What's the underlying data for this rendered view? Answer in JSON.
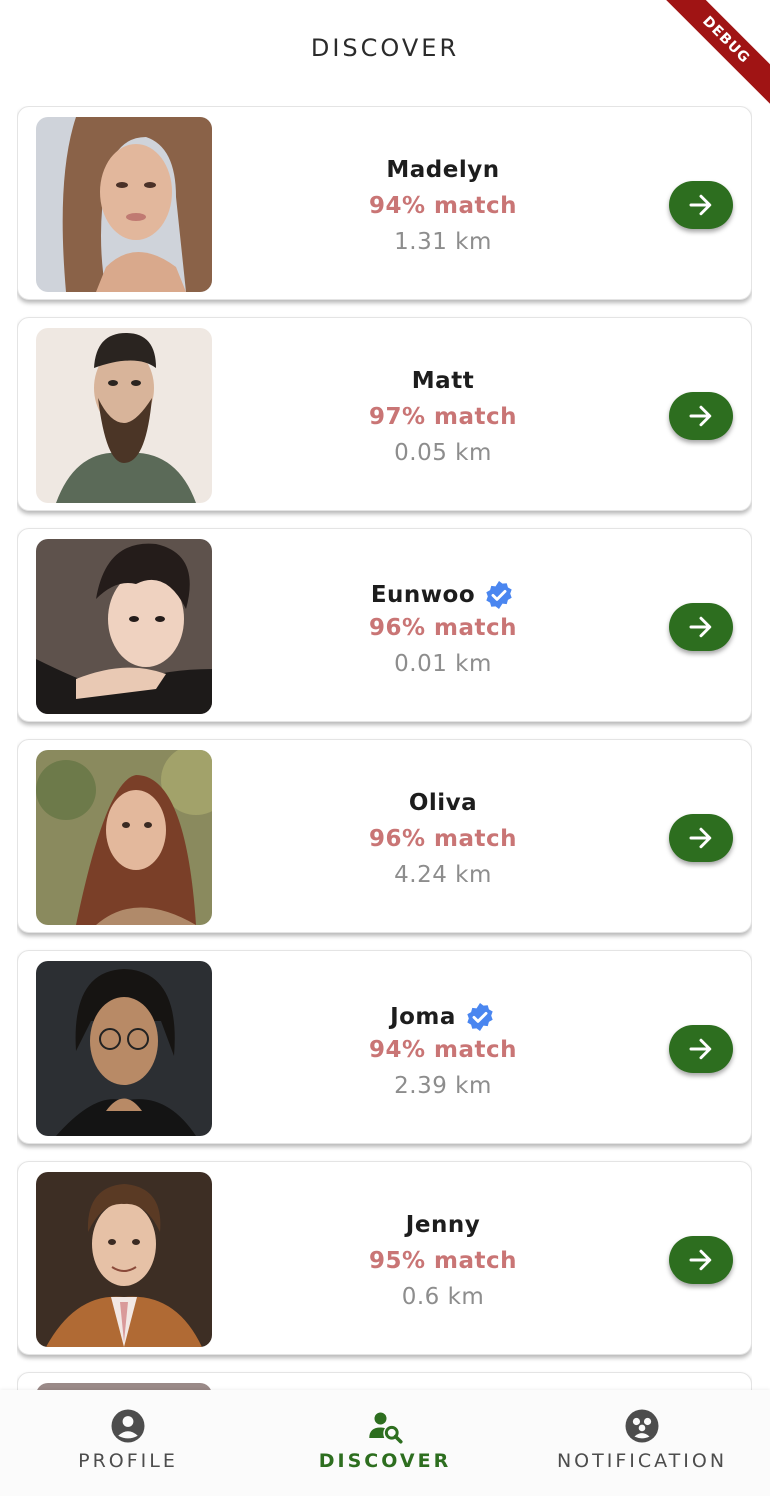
{
  "app": {
    "title": "DISCOVER",
    "debug_label": "DEBUG"
  },
  "colors": {
    "accent": "#2d6e1f",
    "match": "#c97575",
    "distance": "#8d8d8d",
    "verified": "#4a86f0"
  },
  "people": [
    {
      "name": "Madelyn",
      "match": "94% match",
      "distance": "1.31 km",
      "verified": false
    },
    {
      "name": "Matt",
      "match": "97% match",
      "distance": "0.05 km",
      "verified": false
    },
    {
      "name": "Eunwoo",
      "match": "96% match",
      "distance": "0.01 km",
      "verified": true
    },
    {
      "name": "Oliva",
      "match": "96% match",
      "distance": "4.24 km",
      "verified": false
    },
    {
      "name": "Joma",
      "match": "94% match",
      "distance": "2.39 km",
      "verified": true
    },
    {
      "name": "Jenny",
      "match": "95% match",
      "distance": "0.6 km",
      "verified": false
    }
  ],
  "nav": {
    "items": [
      {
        "label": "PROFILE",
        "icon": "person-circle-icon",
        "active": false
      },
      {
        "label": "DISCOVER",
        "icon": "person-search-icon",
        "active": true
      },
      {
        "label": "NOTIFICATION",
        "icon": "group-circle-icon",
        "active": false
      }
    ]
  }
}
